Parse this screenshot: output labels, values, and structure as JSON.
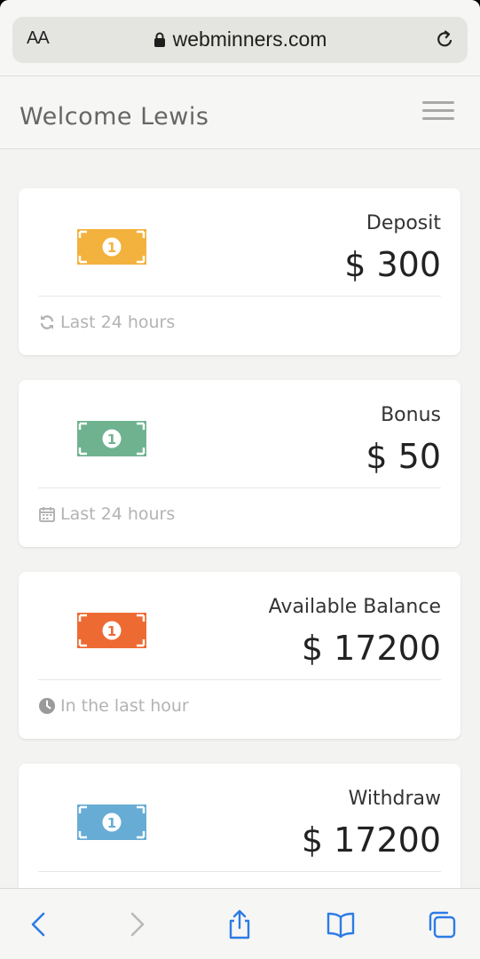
{
  "browser": {
    "text_size_label": "AA",
    "url": "webminners.com"
  },
  "header": {
    "welcome": "Welcome Lewis"
  },
  "cards": [
    {
      "label": "Deposit",
      "value": "$ 300",
      "footer": "Last 24 hours",
      "footer_icon": "refresh-icon",
      "icon_color": "#f3b23e"
    },
    {
      "label": "Bonus",
      "value": "$ 50",
      "footer": "Last 24 hours",
      "footer_icon": "calendar-icon",
      "icon_color": "#6fb28f"
    },
    {
      "label": "Available Balance",
      "value": "$ 17200",
      "footer": "In the last hour",
      "footer_icon": "clock-icon",
      "icon_color": "#ee6a33"
    },
    {
      "label": "Withdraw",
      "value": "$ 17200",
      "footer": "",
      "footer_icon": "",
      "icon_color": "#67acd4"
    }
  ],
  "toolbar": {
    "icons": [
      "back-icon",
      "forward-icon",
      "share-icon",
      "bookmarks-icon",
      "tabs-icon"
    ]
  },
  "colors": {
    "accent_blue": "#2c7be5",
    "background": "#f3f3f1"
  }
}
